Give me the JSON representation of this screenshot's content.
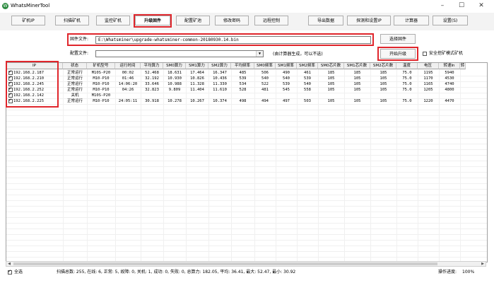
{
  "window": {
    "title": "WhatsMinerTool",
    "min": "–",
    "max": "☐",
    "close": "✕"
  },
  "toolbar": {
    "scan_ip": "矿机IP",
    "scan": "扫描矿机",
    "monitor": "监控矿机",
    "upgrade": "升级固件",
    "configure": "配置矿池",
    "change_password": "修改密码",
    "remote": "远程控制",
    "export": "导出数据",
    "ip_search": "探测和设置IP",
    "calculator": "计算器",
    "settings": "设置(S)"
  },
  "upgrade_panel": {
    "firmware_label": "固件文件:",
    "firmware_path": "E:\\Whatsminer\\upgrade-whatsminer-common-20180930.14.bin",
    "config_label": "配置文件:",
    "config_value": "",
    "config_hint": "(由计算器生成，可以不选)",
    "select_button": "选择固件",
    "start_button": "开始升级",
    "safe_mode_label": "安全挖矿模式矿机"
  },
  "table": {
    "columns": [
      "IP",
      "状态",
      "矿机型号",
      "运行时间",
      "平均算力",
      "SM0算力",
      "SM1算力",
      "SM2算力",
      "平均频率",
      "SM0频率",
      "SM1频率",
      "SM2频率",
      "SM0芯片数",
      "SM1芯片数",
      "SM2芯片数",
      "温度",
      "电压",
      "转速In",
      "转"
    ],
    "rows": [
      {
        "checked": true,
        "cells": [
          "192.168.2.187",
          "正常运行",
          "M10S-P20",
          "00:02",
          "52.468",
          "18.631",
          "17.464",
          "16.347",
          "485",
          "506",
          "490",
          "461",
          "185",
          "185",
          "185",
          "75.0",
          "1195",
          "5940",
          ""
        ]
      },
      {
        "checked": true,
        "cells": [
          "192.168.2.210",
          "正常运行",
          "M10-P10",
          "01:46",
          "32.192",
          "10.930",
          "10.826",
          "10.436",
          "539",
          "540",
          "540",
          "539",
          "105",
          "105",
          "105",
          "75.0",
          "1170",
          "4530",
          ""
        ]
      },
      {
        "checked": true,
        "cells": [
          "192.168.2.245",
          "正常运行",
          "M10-P10",
          "14:06:20",
          "33.646",
          "10.988",
          "11.328",
          "11.330",
          "534",
          "522",
          "539",
          "540",
          "105",
          "105",
          "105",
          "75.0",
          "1165",
          "4740",
          ""
        ]
      },
      {
        "checked": true,
        "cells": [
          "192.168.2.252",
          "正常运行",
          "M10-P10",
          "04:26",
          "32.823",
          "9.809",
          "11.404",
          "11.610",
          "528",
          "481",
          "545",
          "558",
          "105",
          "105",
          "105",
          "75.0",
          "1205",
          "4800",
          ""
        ]
      },
      {
        "checked": true,
        "cells": [
          "192.168.2.142",
          "关机",
          "M10S-P20",
          "",
          "",
          "",
          "",
          "",
          "",
          "",
          "",
          "",
          "",
          "",
          "",
          "",
          "",
          "",
          ""
        ]
      },
      {
        "checked": true,
        "cells": [
          "192.168.2.225",
          "正常运行",
          "M10-P10",
          "24:05:11",
          "30.918",
          "10.278",
          "10.267",
          "10.374",
          "498",
          "494",
          "497",
          "503",
          "105",
          "105",
          "105",
          "75.0",
          "1220",
          "4470",
          ""
        ]
      }
    ]
  },
  "status": {
    "select_all": "全选",
    "summary": "扫描总数: 255, 在线: 6, 正常: 5, 故障: 0, 关机: 1, 成功: 0, 失败: 0, 总算力: 182.05, 平均: 36.41, 最大: 52.47, 最小: 30.92",
    "progress_label": "操作进度:",
    "progress_value": "100%"
  },
  "colors": {
    "highlight": "#e0262c",
    "toolbar_bg": "#f3f3f3",
    "header_bg": "#f0f0f0"
  }
}
